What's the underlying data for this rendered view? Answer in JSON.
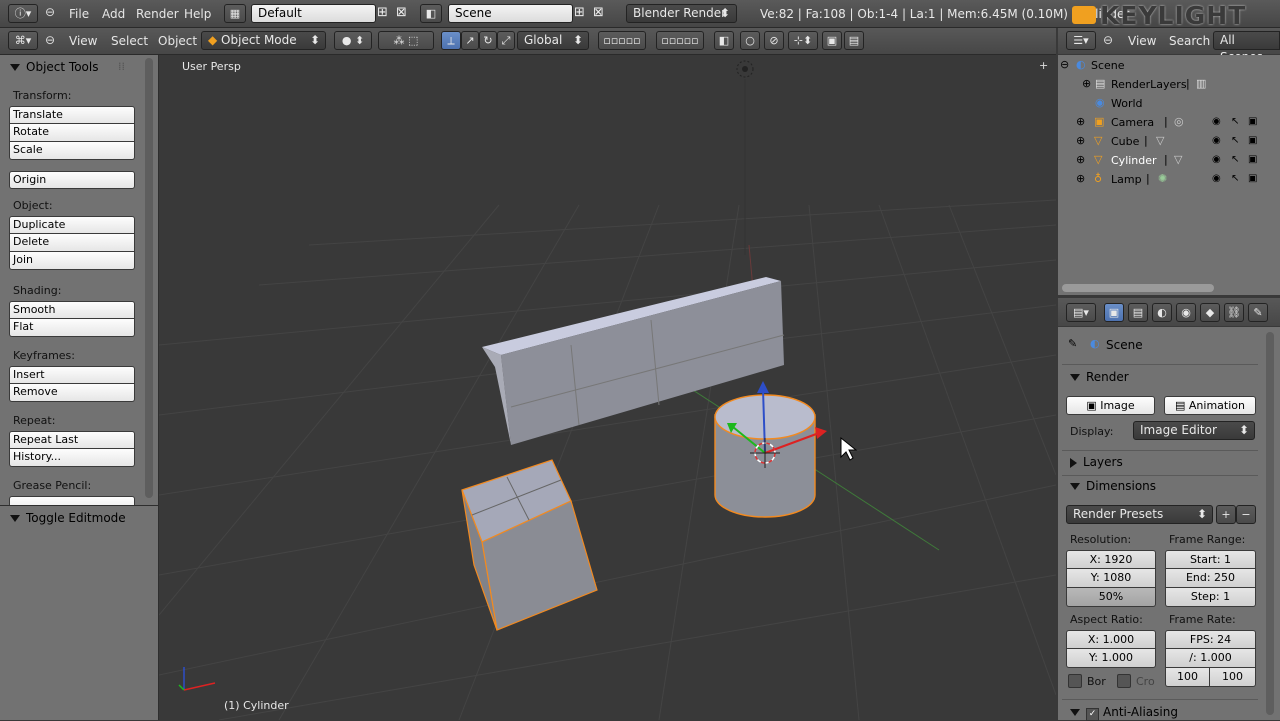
{
  "info_header": {
    "menus": [
      "File",
      "Add",
      "Render",
      "Help"
    ],
    "layout_name": "Default",
    "scene_name": "Scene",
    "render_engine": "Blender Render",
    "stats": "Ve:82 | Fa:108 | Ob:1-4 | La:1 | Mem:6.45M (0.10M) | Cylinder",
    "watermark": "KEYLIGHT"
  },
  "view3d_header": {
    "menus": [
      "View",
      "Select",
      "Object"
    ],
    "mode": "Object Mode",
    "orientation": "Global"
  },
  "tool_shelf": {
    "object_tools_title": "Object Tools",
    "sections": {
      "transform_label": "Transform:",
      "translate": "Translate",
      "rotate": "Rotate",
      "scale": "Scale",
      "origin": "Origin",
      "object_label": "Object:",
      "duplicate": "Duplicate",
      "delete": "Delete",
      "join": "Join",
      "shading_label": "Shading:",
      "smooth": "Smooth",
      "flat": "Flat",
      "keyframes_label": "Keyframes:",
      "insert": "Insert",
      "remove": "Remove",
      "repeat_label": "Repeat:",
      "repeat_last": "Repeat Last",
      "history": "History...",
      "grease_label": "Grease Pencil:"
    },
    "toggle_editmode_title": "Toggle Editmode"
  },
  "viewport": {
    "view_name": "User Persp",
    "active_object": "(1) Cylinder"
  },
  "outliner": {
    "menus": [
      "View",
      "Search"
    ],
    "filter": "All Scenes",
    "items": [
      {
        "label": "Scene",
        "depth": 0
      },
      {
        "label": "RenderLayers",
        "depth": 1
      },
      {
        "label": "World",
        "depth": 1
      },
      {
        "label": "Camera",
        "depth": 1
      },
      {
        "label": "Cube",
        "depth": 1
      },
      {
        "label": "Cylinder",
        "depth": 1
      },
      {
        "label": "Lamp",
        "depth": 1
      }
    ]
  },
  "properties": {
    "context": "Scene",
    "render_title": "Render",
    "image_btn": "Image",
    "animation_btn": "Animation",
    "display_label": "Display:",
    "display_value": "Image Editor",
    "layers_title": "Layers",
    "dimensions_title": "Dimensions",
    "render_presets": "Render Presets",
    "resolution_label": "Resolution:",
    "res_x": "X: 1920",
    "res_y": "Y: 1080",
    "res_pct": "50%",
    "frame_range_label": "Frame Range:",
    "start": "Start: 1",
    "end": "End: 250",
    "step": "Step: 1",
    "aspect_label": "Aspect Ratio:",
    "aspect_x": "X: 1.000",
    "aspect_y": "Y: 1.000",
    "frame_rate_label": "Frame Rate:",
    "fps": "FPS: 24",
    "fps_base": "/: 1.000",
    "time_old": "100",
    "time_new": "100",
    "border_label": "Bor",
    "crop_label": "Cro",
    "aa_title": "Anti-Aliasing"
  },
  "colors": {
    "selection_orange": "#f28a20",
    "active_text": "#ffffff"
  }
}
